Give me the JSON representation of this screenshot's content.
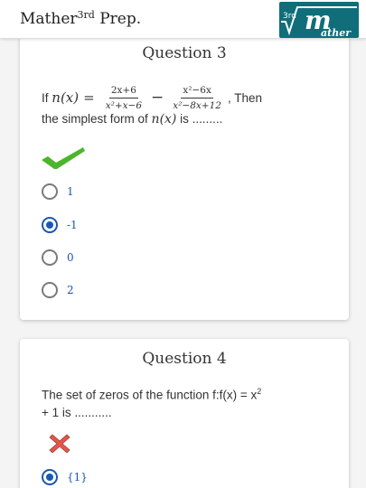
{
  "header": {
    "app_name": "Mather",
    "app_sup": "3rd",
    "app_suffix": " Prep.",
    "logo_badge": "3rd",
    "logo_letter": "m",
    "logo_word": "ather"
  },
  "questions": [
    {
      "title": "Question 3",
      "prefix": "If",
      "func": "n(x)",
      "equals": "=",
      "frac1_num": "2x+6",
      "frac1_den": "x²+x−6",
      "minus": "−",
      "frac2_num": "x²−6x",
      "frac2_den": "x²−8x+12",
      "suffix": ", Then",
      "line2_a": "the simplest form of ",
      "line2_func": "n(x)",
      "line2_b": " is .........",
      "result": "correct",
      "result_icon": "checkmark-icon",
      "options": [
        {
          "label": "1",
          "selected": false
        },
        {
          "label": "-1",
          "selected": true
        },
        {
          "label": "0",
          "selected": false
        },
        {
          "label": "2",
          "selected": false
        }
      ]
    },
    {
      "title": "Question 4",
      "text_a": "The set of zeros of the function f:f(x) = x",
      "text_sup": "2",
      "text_b": "+ 1 is ...........",
      "result": "wrong",
      "result_icon": "cross-icon",
      "options": [
        {
          "label": "{1}",
          "selected": true
        }
      ]
    }
  ],
  "colors": {
    "accent": "#1a57b5",
    "correct": "#4cb52d",
    "wrong": "#e2574c",
    "logo_bg": "#0f6e7a"
  }
}
